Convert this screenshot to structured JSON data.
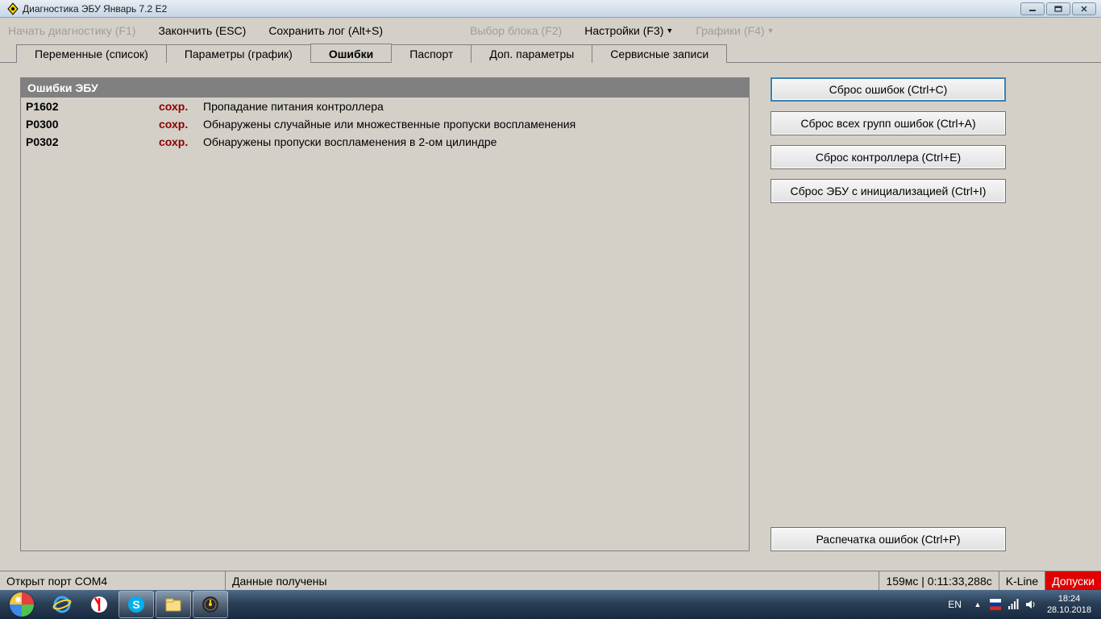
{
  "window": {
    "title": "Диагностика ЭБУ Январь 7.2 Е2"
  },
  "menu": {
    "start": "Начать диагностику (F1)",
    "finish": "Закончить (ESC)",
    "save_log": "Сохранить лог (Alt+S)",
    "block_select": "Выбор блока (F2)",
    "settings": "Настройки (F3)",
    "charts": "Графики (F4)"
  },
  "tabs": {
    "vars": "Переменные (список)",
    "params": "Параметры (график)",
    "errors": "Ошибки",
    "passport": "Паспорт",
    "extra": "Доп. параметры",
    "service": "Сервисные записи"
  },
  "panel": {
    "header": "Ошибки ЭБУ"
  },
  "errors": [
    {
      "code": "P1602",
      "status": "сохр.",
      "desc": "Пропадание питания контроллера"
    },
    {
      "code": "P0300",
      "status": "сохр.",
      "desc": "Обнаружены случайные или множественные пропуски воспламенения"
    },
    {
      "code": "P0302",
      "status": "сохр.",
      "desc": "Обнаружены пропуски воспламенения в 2-ом цилиндре"
    }
  ],
  "buttons": {
    "reset_errors": "Сброс ошибок (Ctrl+C)",
    "reset_all_groups": "Сброс всех групп ошибок (Ctrl+A)",
    "reset_controller": "Сброс контроллера (Ctrl+E)",
    "reset_ecu_init": "Сброс ЭБУ с инициализацией (Ctrl+I)",
    "print_errors": "Распечатка ошибок (Ctrl+P)"
  },
  "status": {
    "port": "Открыт порт COM4",
    "data": "Данные получены",
    "timing": "159мс | 0:11:33,288с",
    "kline": "K-Line",
    "allow": "Допуски"
  },
  "tray": {
    "lang": "EN",
    "time": "18:24",
    "date": "28.10.2018"
  }
}
